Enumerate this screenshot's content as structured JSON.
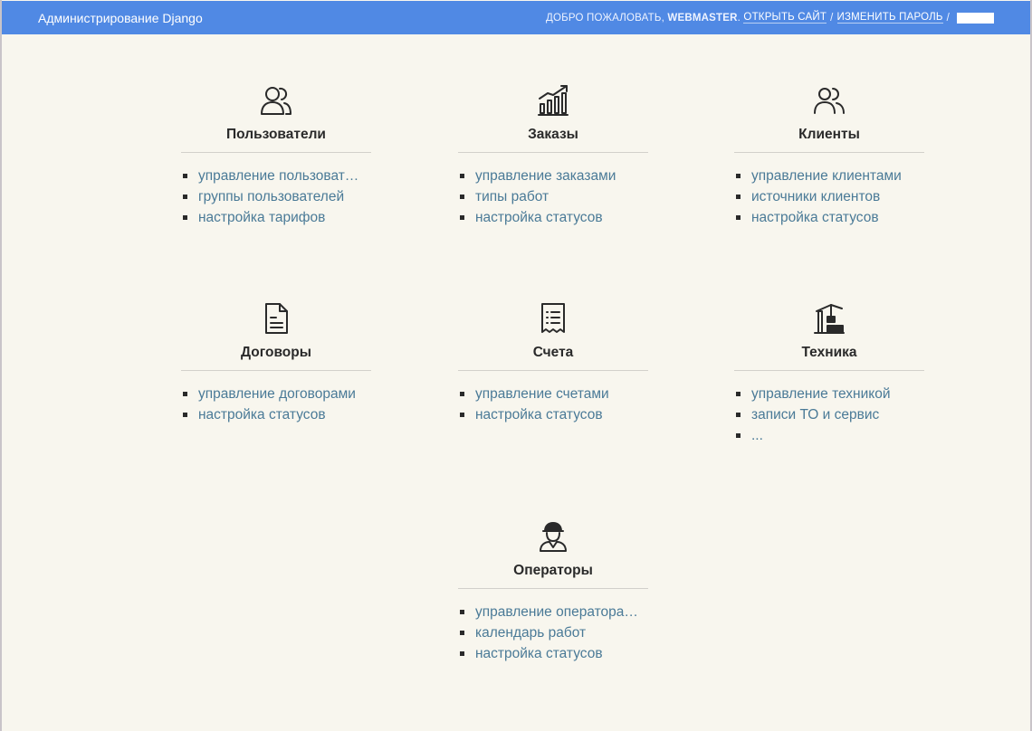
{
  "header": {
    "brand": "Администрирование Django",
    "welcome_prefix": "ДОБРО ПОЖАЛОВАТЬ,",
    "username": "WEBMASTER",
    "username_suffix": ".",
    "view_site": "ОТКРЫТЬ САЙТ",
    "separator": "/",
    "change_password": "ИЗМЕНИТЬ ПАРОЛЬ"
  },
  "cards": [
    {
      "title": "Пользователи",
      "icon": "users-icon",
      "items": [
        "управление пользователями",
        "группы пользователей",
        "настройка тарифов"
      ]
    },
    {
      "title": "Заказы",
      "icon": "chart-growth-icon",
      "items": [
        "управление заказами",
        "типы работ",
        "настройка статусов"
      ]
    },
    {
      "title": "Клиенты",
      "icon": "clients-icon",
      "items": [
        "управление клиентами",
        "источники клиентов",
        "настройка статусов"
      ]
    },
    {
      "title": "Договоры",
      "icon": "document-icon",
      "items": [
        "управление договорами",
        "настройка статусов"
      ]
    },
    {
      "title": "Счета",
      "icon": "receipt-icon",
      "items": [
        "управление счетами",
        "настройка статусов"
      ]
    },
    {
      "title": "Техника",
      "icon": "crane-icon",
      "items": [
        "управление техникой",
        "записи ТО и сервис",
        "..."
      ]
    },
    {
      "title": "Операторы",
      "icon": "worker-icon",
      "items": [
        "управление операторами",
        "календарь работ",
        "настройка статусов"
      ]
    }
  ]
}
